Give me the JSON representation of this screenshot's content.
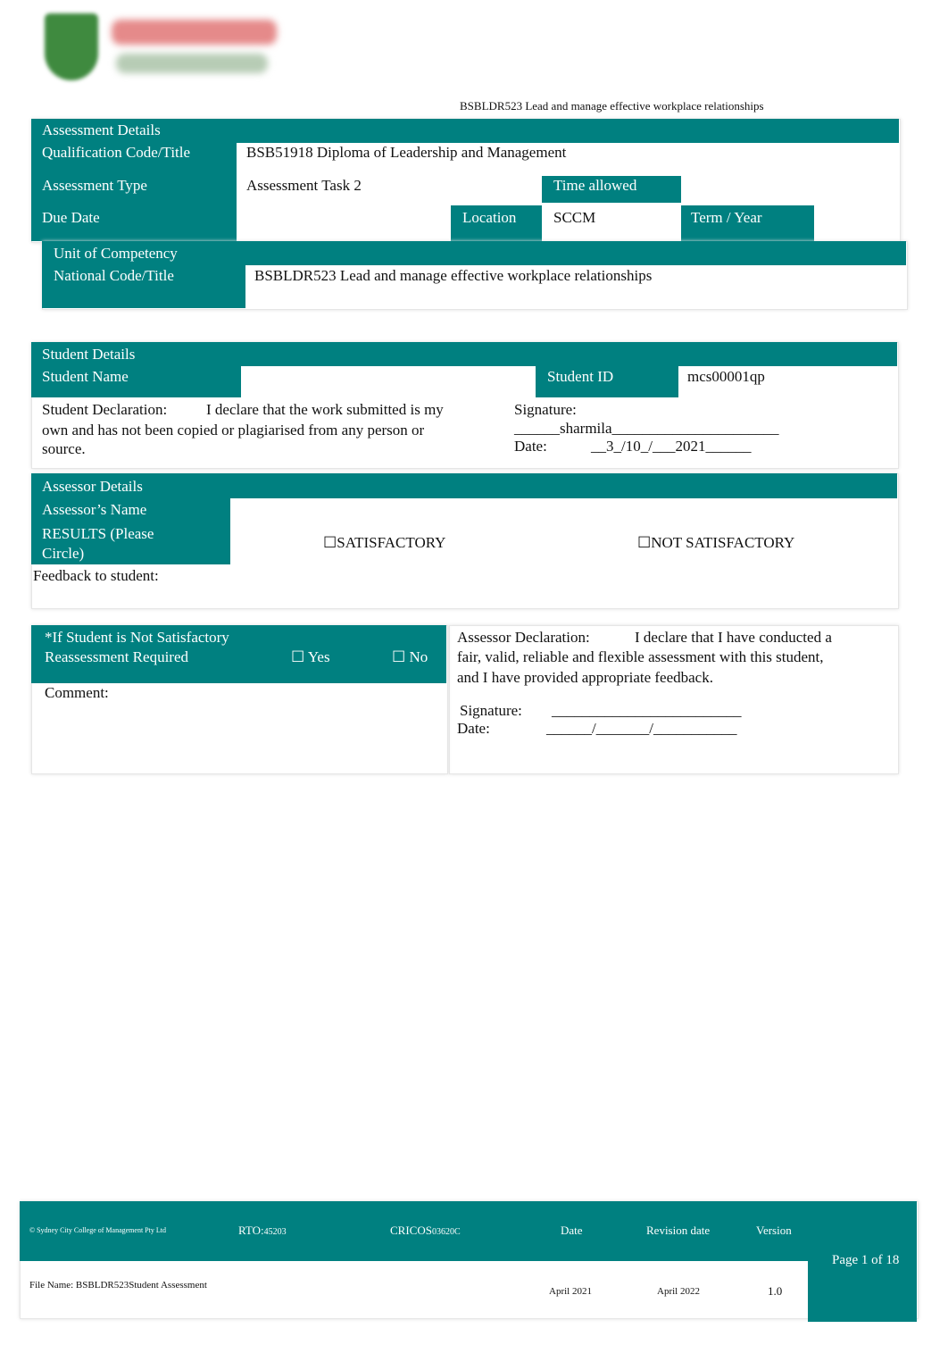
{
  "logo": {
    "text": "Sydney City College of Management"
  },
  "header": {
    "unit_title": "BSBLDR523 Lead and manage effective workplace relationships"
  },
  "assessment": {
    "section_title": "Assessment Details",
    "qualification_label": "Qualification Code/Title",
    "qualification_value": "BSB51918 Diploma of Leadership and Management",
    "type_label": "Assessment Type",
    "type_value": "Assessment Task 2",
    "time_allowed_label": "Time allowed",
    "time_allowed_value": "",
    "due_date_label": "Due Date",
    "due_date_value": "",
    "location_label": "Location",
    "location_value": "SCCM",
    "term_label": "Term / Year",
    "term_value": "",
    "unit_label_1": "Unit of Competency",
    "unit_label_2": "National Code/Title",
    "unit_value": "BSBLDR523 Lead and manage effective workplace relationships"
  },
  "student": {
    "section_title": "Student Details",
    "name_label": "Student Name",
    "name_value": "",
    "id_label": "Student ID",
    "id_value": "mcs00001qp",
    "declaration_label": "Student Declaration:",
    "declaration_line1": "I declare that the work submitted is my",
    "declaration_line2": "own and has not been copied or plagiarised from any person or",
    "declaration_line3": "source.",
    "signature_label": "Signature:",
    "signature_value": "______sharmila______________________",
    "date_label": "Date:",
    "date_value": "__3_/10_/___2021______"
  },
  "assessor": {
    "section_title": "Assessor Details",
    "name_label": "Assessor’s Name",
    "results_label_1": "RESULTS (Please",
    "results_label_2": "Circle)",
    "satisfactory": "☐SATISFACTORY",
    "not_satisfactory": "☐NOT SATISFACTORY",
    "feedback_label": "Feedback to student:"
  },
  "reassessment": {
    "label_1": "*If Student is Not Satisfactory",
    "label_2": "Reassessment Required",
    "yes": "☐  Yes",
    "no": "☐  No",
    "comment_label": "Comment:"
  },
  "assessor_declaration": {
    "label": "Assessor Declaration:",
    "line1": "I declare that I have conducted a",
    "line2": "fair, valid, reliable and flexible assessment with this student,",
    "line3": "and I have provided appropriate feedback.",
    "signature_label": "Signature:",
    "signature_line": "_________________________",
    "date_label": "Date:",
    "date_line": "______/_______/___________"
  },
  "footer": {
    "copyright": "© Sydney City College of Management Pty Ltd",
    "rto_label": "RTO:",
    "rto_value": "45203",
    "cricos_label": "CRICOS",
    "cricos_value": "03620C",
    "date_label": "Date",
    "revision_label": "Revision date",
    "version_label": "Version",
    "file_name": "File Name: BSBLDR523Student Assessment",
    "date_value": "April 2021",
    "revision_value": "April 2022",
    "version_value": "1.0",
    "page": "Page 1 of 18"
  },
  "colors": {
    "accent": "#008080"
  }
}
